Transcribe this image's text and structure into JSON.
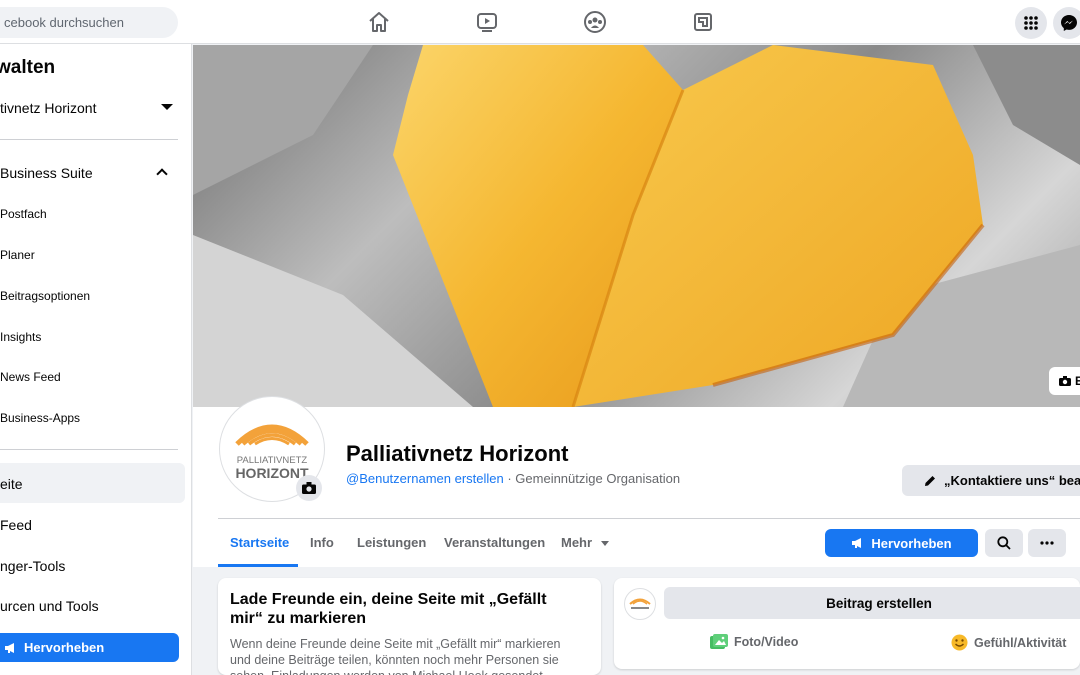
{
  "topbar": {
    "search_placeholder": "cebook durchsuchen",
    "nav_icons": [
      "home-icon",
      "watch-icon",
      "groups-icon",
      "gaming-icon"
    ],
    "right_icons": [
      "menu-grid-icon",
      "messenger-icon"
    ]
  },
  "sidebar": {
    "title": "walten",
    "page_selector": "tivnetz Horizont",
    "suite_label": "Business Suite",
    "suite_items": [
      "Postfach",
      "Planer",
      "Beitragsoptionen",
      "Insights",
      "News Feed",
      "Business-Apps"
    ],
    "main_items": [
      "eite",
      "Feed",
      "nger-Tools",
      "urcen und Tools"
    ],
    "boost_label": "Hervorheben"
  },
  "cover": {
    "edit_label": "E"
  },
  "profile": {
    "name": "Palliativnetz Horizont",
    "username_link": "@Benutzernamen erstellen",
    "category": " · Gemeinnützige Organisation",
    "contact_button": "„Kontaktiere uns“ bear",
    "logo_line1": "PALLIATIVNETZ",
    "logo_line2": "HORIZONT"
  },
  "tabs": {
    "items": [
      "Startseite",
      "Info",
      "Leistungen",
      "Veranstaltungen",
      "Mehr"
    ],
    "boost_label": "Hervorheben"
  },
  "invite_card": {
    "title": "Lade Freunde ein, deine Seite mit „Gefällt mir“ zu markieren",
    "text": "Wenn deine Freunde deine Seite mit „Gefällt mir“ markieren und deine Beiträge teilen, könnten noch mehr Personen sie sehen. Einladungen werden von Michael Hoek gesendet."
  },
  "composer": {
    "create_label": "Beitrag erstellen",
    "photo_label": "Foto/Video",
    "feeling_label": "Gefühl/Aktivität"
  },
  "colors": {
    "brand_blue": "#1877f2",
    "heart_orange": "#f5a623"
  }
}
